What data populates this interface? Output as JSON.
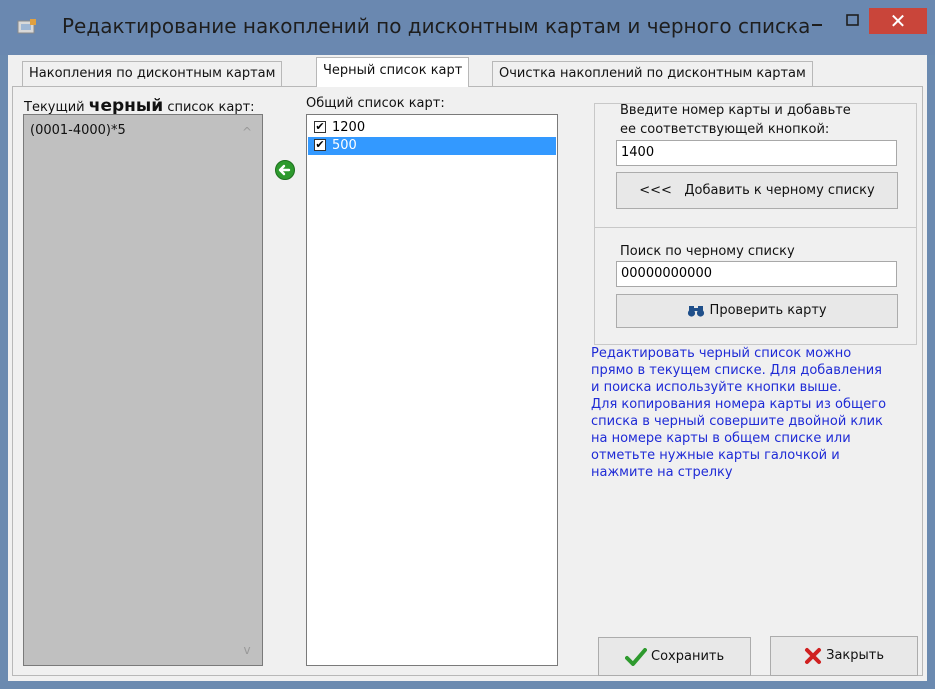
{
  "window": {
    "title": "Редактирование накоплений по дисконтным картам и черного списка",
    "close_glyph": "✕",
    "colors": {
      "titlebar": "#6a88b0",
      "close": "#c9453a",
      "selection": "#3399ff",
      "hint_text": "#1f2bd6"
    }
  },
  "tabs": [
    {
      "label": "Накопления по дисконтным картам",
      "active": false
    },
    {
      "label": "Черный список карт",
      "active": true
    },
    {
      "label": "Очистка накоплений по дисконтным картам",
      "active": false
    }
  ],
  "current_list": {
    "label_prefix": "Текущий",
    "label_bold": "черный",
    "label_suffix": "список карт:",
    "items": [
      "(0001-4000)*5"
    ],
    "scroll_up_glyph": "^",
    "scroll_down_glyph": "v"
  },
  "general_list": {
    "label": "Общий список карт:",
    "items": [
      {
        "text": "1200",
        "checked": true,
        "selected": false
      },
      {
        "text": "500",
        "checked": true,
        "selected": true
      }
    ],
    "check_glyph": "✔"
  },
  "add_section": {
    "instruction": "Введите номер карты и добавьте\nее соответствующей кнопкой:",
    "card_input_value": "1400",
    "add_button_arrows": "<<<",
    "add_button_label": "Добавить к черному списку"
  },
  "search_section": {
    "label": "Поиск по черному списку",
    "search_input_value": "00000000000",
    "check_button_label": "Проверить карту"
  },
  "hint": "Редактировать черный список можно\nпрямо в текущем списке. Для добавления\nи поиска используйте кнопки выше.\nДля копирования номера карты из общего\nсписка в черный совершите двойной клик\nна номере карты в общем списке или\nотметьте нужные карты галочкой и\nнажмите на стрелку",
  "footer": {
    "save_label": "Сохранить",
    "close_label": "Закрыть"
  }
}
